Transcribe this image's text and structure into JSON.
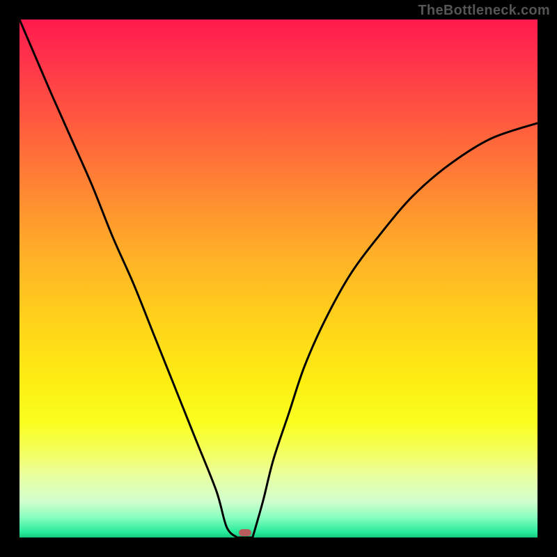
{
  "watermark": "TheBottleneck.com",
  "chart_data": {
    "type": "line",
    "title": "",
    "xlabel": "",
    "ylabel": "",
    "xlim": [
      0,
      1
    ],
    "ylim": [
      0,
      1
    ],
    "series": [
      {
        "name": "bottleneck-curve-left",
        "x": [
          0.0,
          0.03,
          0.06,
          0.1,
          0.14,
          0.18,
          0.22,
          0.26,
          0.3,
          0.34,
          0.38,
          0.4,
          0.42
        ],
        "values": [
          1.0,
          0.93,
          0.86,
          0.77,
          0.68,
          0.58,
          0.49,
          0.39,
          0.29,
          0.19,
          0.09,
          0.02,
          0.0
        ]
      },
      {
        "name": "bottleneck-curve-right",
        "x": [
          0.45,
          0.47,
          0.49,
          0.52,
          0.55,
          0.59,
          0.64,
          0.7,
          0.76,
          0.83,
          0.91,
          1.0
        ],
        "values": [
          0.0,
          0.07,
          0.15,
          0.24,
          0.33,
          0.42,
          0.51,
          0.59,
          0.66,
          0.72,
          0.77,
          0.8
        ]
      }
    ],
    "plateau": {
      "x_start": 0.42,
      "x_end": 0.45,
      "y": 0.0
    },
    "marker": {
      "x": 0.435,
      "y": 0.01
    },
    "gradient_stops": [
      {
        "pos": 0.0,
        "color": "#ff1a4d"
      },
      {
        "pos": 0.5,
        "color": "#ffd21a"
      },
      {
        "pos": 0.8,
        "color": "#f9ff20"
      },
      {
        "pos": 1.0,
        "color": "#14c97f"
      }
    ]
  }
}
